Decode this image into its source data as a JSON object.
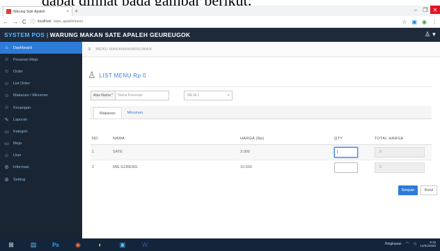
{
  "caption": "dapat dilihat pada gambar berikut:",
  "browser": {
    "tab_title": "Warung Sate Apaleh",
    "tab_close": "×",
    "new_tab": "+",
    "window_controls": [
      "–",
      "❐",
      "✕"
    ],
    "nav": {
      "back": "←",
      "forward": "→",
      "reload": "C"
    },
    "url_host": "localhost",
    "url_path": "/sate_apaleh/menu",
    "addr_icons": {
      "star": "☆",
      "menu": "⋮"
    }
  },
  "app": {
    "brand": "SYSTEM POS |",
    "title": "WARUNG MAKAN SATE APALEH GEUREUGOK",
    "user_icon": "user-icon"
  },
  "sidebar": {
    "items": [
      {
        "label": "Dashboard",
        "icon": "⌂",
        "icon_name": "dashboard-icon",
        "active": true
      },
      {
        "label": "Pesanan Meja",
        "icon": "☺",
        "icon_name": "user-icon",
        "active": false
      },
      {
        "label": "Order",
        "icon": "☺",
        "icon_name": "user-icon",
        "active": false
      },
      {
        "label": "List Order",
        "icon": "☺",
        "icon_name": "user-icon",
        "active": false
      },
      {
        "label": "Makanan / Minuman",
        "icon": "☺",
        "icon_name": "user-icon",
        "active": false
      },
      {
        "label": "Keuangan",
        "icon": "☺",
        "icon_name": "user-icon",
        "active": false
      },
      {
        "label": "Laporan",
        "icon": "✎",
        "icon_name": "pencil-icon",
        "active": false
      },
      {
        "label": "Kategori",
        "icon": "▭",
        "icon_name": "folder-icon",
        "active": false
      },
      {
        "label": "Meja",
        "icon": "▭",
        "icon_name": "table-icon",
        "active": false
      },
      {
        "label": "User",
        "icon": "☺",
        "icon_name": "user-icon",
        "active": false
      },
      {
        "label": "Informasi",
        "icon": "⚙",
        "icon_name": "gear-icon",
        "active": false
      },
      {
        "label": "Setting",
        "icon": "⚙",
        "icon_name": "gear-icon",
        "active": false
      }
    ]
  },
  "breadcrumb": {
    "icon": "⚙",
    "text": "MENU MAKANAN/MINUMAN"
  },
  "list": {
    "icon": "user-icon",
    "title": "LIST MENU Rp 0"
  },
  "filters": {
    "nama_label": "Atas Nama *",
    "nama_placeholder": "Nama Pemesan",
    "meja_value": "MEJA 1",
    "meja_caret": "▾"
  },
  "tabs": [
    {
      "label": "Makanan",
      "active": true
    },
    {
      "label": "Minuman",
      "active": false
    }
  ],
  "table": {
    "headers": {
      "no": "NO",
      "nama": "NAMA",
      "harga": "HARGA (Rp)",
      "qty": "QTY",
      "total": "TOTAL HARGA"
    },
    "rows": [
      {
        "no": "1",
        "nama": "SATE",
        "harga": "3.000",
        "qty": "|",
        "total": "0"
      },
      {
        "no": "2",
        "nama": "MIE GORENG",
        "harga": "10.000",
        "qty": "",
        "total": "0"
      }
    ]
  },
  "buttons": {
    "simpan": "Simpan",
    "batal": "Batal"
  },
  "taskbar": {
    "apps": [
      "⊞",
      "▤",
      "Ps",
      "◉",
      "◐",
      "▣",
      "W"
    ],
    "tray_text": "Ringkasan",
    "time": "9:15",
    "date": "12/01/2020"
  },
  "colors": {
    "accent": "#2d7bd8",
    "header_bg": "#1f2b3a",
    "sidebar_bg": "#1a2533",
    "brand": "#58b4ff"
  }
}
